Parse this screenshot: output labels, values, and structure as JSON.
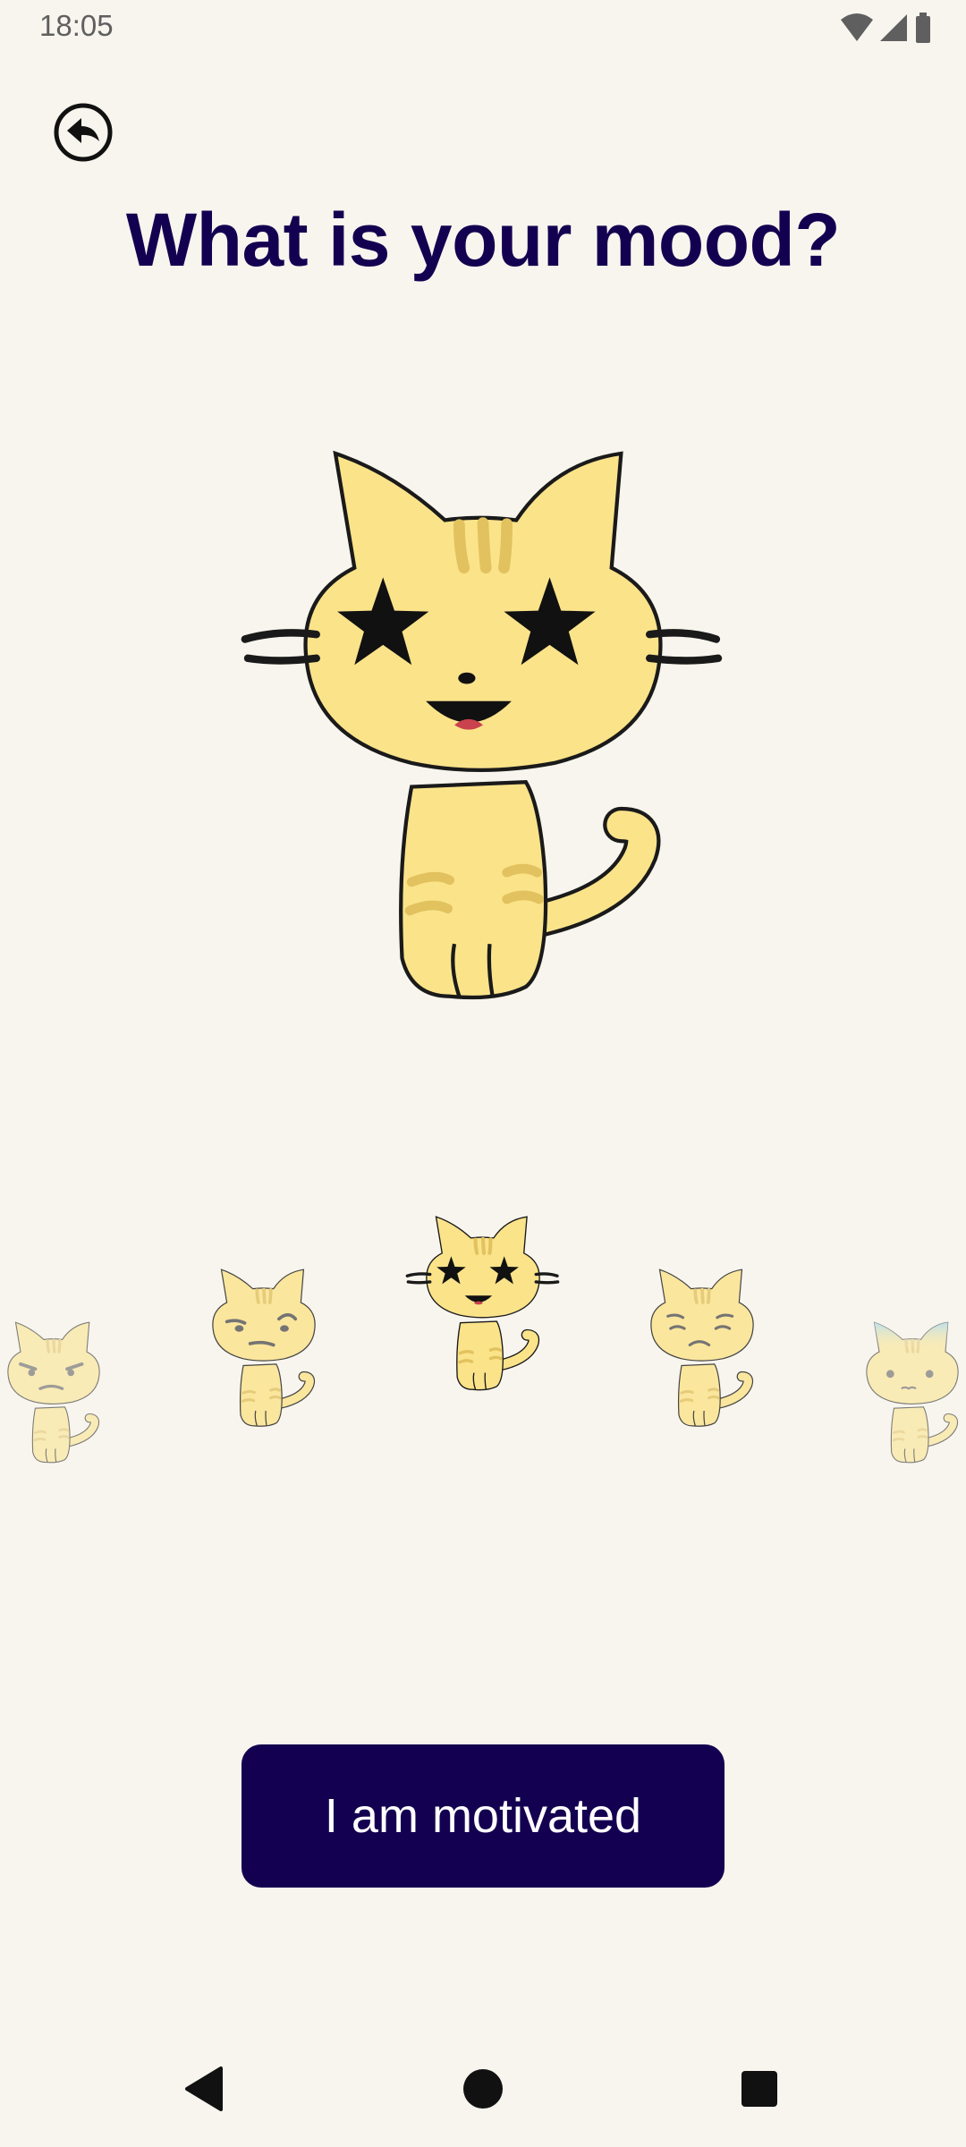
{
  "status_bar": {
    "time": "18:05",
    "icons": [
      "wifi-icon",
      "cellular-signal-icon",
      "battery-icon"
    ]
  },
  "header": {
    "back_icon": "back-arrow-circle-icon",
    "title": "What is your mood?"
  },
  "hero": {
    "mood": "motivated",
    "description": "yellow tabby cat with star eyes"
  },
  "mood_carousel": {
    "items": [
      {
        "mood": "angry",
        "selected": false
      },
      {
        "mood": "skeptical",
        "selected": false
      },
      {
        "mood": "motivated",
        "selected": true
      },
      {
        "mood": "sad",
        "selected": false
      },
      {
        "mood": "anxious",
        "selected": false
      }
    ]
  },
  "action": {
    "label": "I am motivated"
  },
  "nav_bar": {
    "icons": [
      "back-triangle-icon",
      "home-circle-icon",
      "recents-square-icon"
    ]
  },
  "colors": {
    "background": "#f8f5ee",
    "primary": "#140050",
    "cat_fur": "#fbe38a",
    "cat_stripe": "#e2c25e"
  }
}
